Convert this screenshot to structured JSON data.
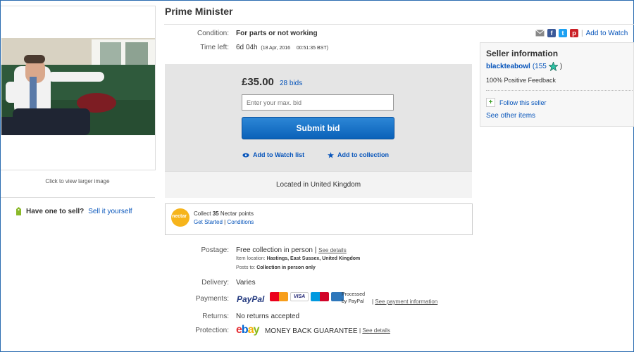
{
  "item": {
    "title": "Prime Minister",
    "click_larger": "Click to view larger image",
    "condition_label": "Condition:",
    "condition_value": "For parts or not working",
    "time_left_label": "Time left:",
    "time_left_value": "6d 04h",
    "time_left_date": "(18 Apr, 2016",
    "time_left_time": "00:51:35 BST)"
  },
  "sell": {
    "question": "Have one to sell?",
    "link": "Sell it yourself"
  },
  "bid": {
    "price": "£35.00",
    "bids": "28 bids",
    "placeholder": "Enter your max. bid",
    "submit": "Submit bid",
    "watch": "Add to Watch list",
    "collection": "Add to collection",
    "location": "Located in United Kingdom"
  },
  "nectar": {
    "logo": "nectar",
    "collect_prefix": "Collect",
    "points": "35",
    "collect_suffix": "Nectar points",
    "get_started": "Get Started",
    "sep": "|",
    "conditions": "Conditions"
  },
  "share": {
    "watch_link": "Add to Watch"
  },
  "seller": {
    "heading": "Seller information",
    "name": "blackteabowl",
    "score_open": "(155",
    "score_close": ")",
    "feedback": "100% Positive Feedback",
    "follow": "Follow this seller",
    "other": "See other items"
  },
  "postage": {
    "label": "Postage:",
    "value": "Free collection in person",
    "sep": "|",
    "see": "See details",
    "location_label": "Item location:",
    "location_value": "Hastings, East Sussex, United Kingdom",
    "posts_label": "Posts to:",
    "posts_value": "Collection in person only"
  },
  "delivery": {
    "label": "Delivery:",
    "value": "Varies"
  },
  "payments": {
    "label": "Payments:",
    "paypal": "PayPal",
    "processed1": "Processed",
    "processed2": "by PayPal",
    "sep": "|",
    "see": "See payment information",
    "visa": "VISA"
  },
  "returns": {
    "label": "Returns:",
    "value": "No returns accepted"
  },
  "protection": {
    "label": "Protection:",
    "ebay_e": "e",
    "ebay_b": "b",
    "ebay_a": "a",
    "ebay_y": "y",
    "guarantee": "MONEY BACK GUARANTEE",
    "sep": "|",
    "see": "See details"
  },
  "colors": {
    "link": "#0654ba",
    "button": "#0a61b9",
    "paypal_dark": "#253b80",
    "paypal_light": "#179bd7"
  }
}
